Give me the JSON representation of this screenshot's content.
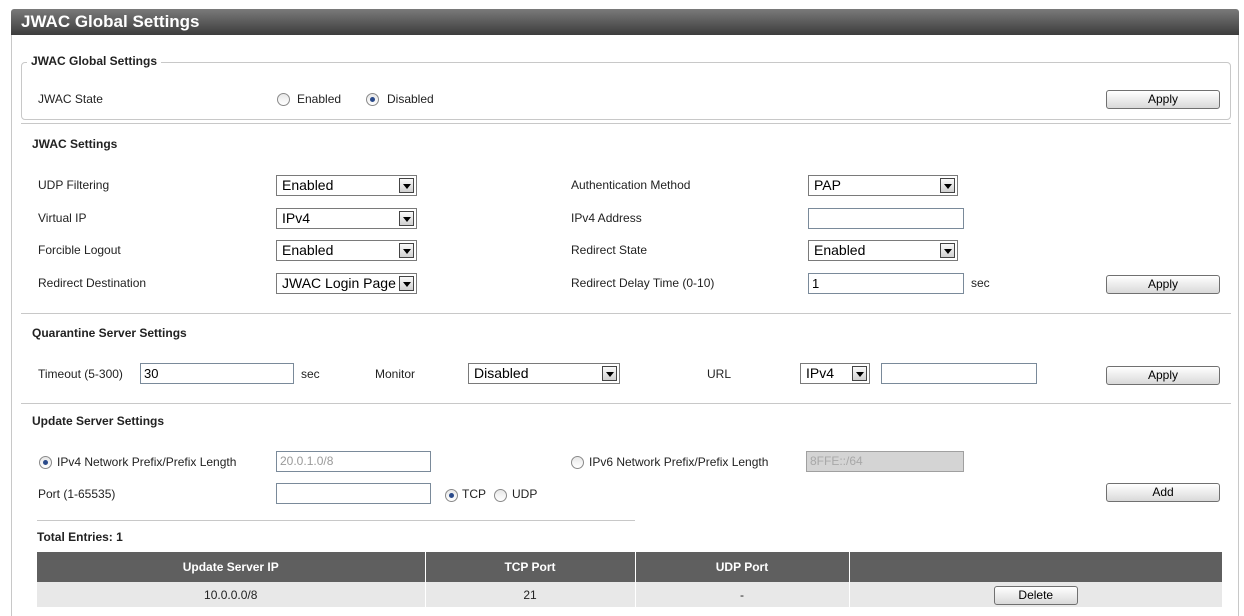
{
  "page": {
    "title": "JWAC Global Settings"
  },
  "global_settings": {
    "legend": "JWAC Global Settings",
    "state_label": "JWAC State",
    "options": [
      "Enabled",
      "Disabled"
    ],
    "selected": "Disabled",
    "apply_label": "Apply"
  },
  "jwac_settings": {
    "title": "JWAC Settings",
    "udp_filtering_label": "UDP Filtering",
    "udp_filtering_value": "Enabled",
    "virtual_ip_label": "Virtual IP",
    "virtual_ip_value": "IPv4",
    "forcible_logout_label": "Forcible Logout",
    "forcible_logout_value": "Enabled",
    "redirect_destination_label": "Redirect Destination",
    "redirect_destination_value": "JWAC Login Page",
    "auth_method_label": "Authentication Method",
    "auth_method_value": "PAP",
    "ipv4_address_label": "IPv4 Address",
    "ipv4_address_value": "",
    "redirect_state_label": "Redirect State",
    "redirect_state_value": "Enabled",
    "redirect_delay_label": "Redirect Delay Time (0-10)",
    "redirect_delay_value": "1",
    "sec_unit": "sec",
    "apply_label": "Apply"
  },
  "quarantine": {
    "title": "Quarantine Server Settings",
    "timeout_label": "Timeout (5-300)",
    "timeout_value": "30",
    "sec_unit": "sec",
    "monitor_label": "Monitor",
    "monitor_value": "Disabled",
    "url_label": "URL",
    "url_type_value": "IPv4",
    "url_value": "",
    "apply_label": "Apply"
  },
  "update_server": {
    "title": "Update Server Settings",
    "ipv4_prefix_label": "IPv4 Network Prefix/Prefix Length",
    "ipv4_prefix_placeholder": "20.0.1.0/8",
    "ipv6_prefix_label": "IPv6 Network Prefix/Prefix Length",
    "ipv6_prefix_placeholder": "8FFE::/64",
    "selected_prefix": "IPv4",
    "port_label": "Port (1-65535)",
    "port_value": "",
    "protocol_options": [
      "TCP",
      "UDP"
    ],
    "selected_protocol": "TCP",
    "add_label": "Add"
  },
  "table": {
    "total_entries_label": "Total Entries: 1",
    "columns": [
      "Update Server IP",
      "TCP Port",
      "UDP Port",
      ""
    ],
    "rows": [
      {
        "ip": "10.0.0.0/8",
        "tcp_port": "21",
        "udp_port": "-",
        "action_label": "Delete"
      }
    ]
  }
}
